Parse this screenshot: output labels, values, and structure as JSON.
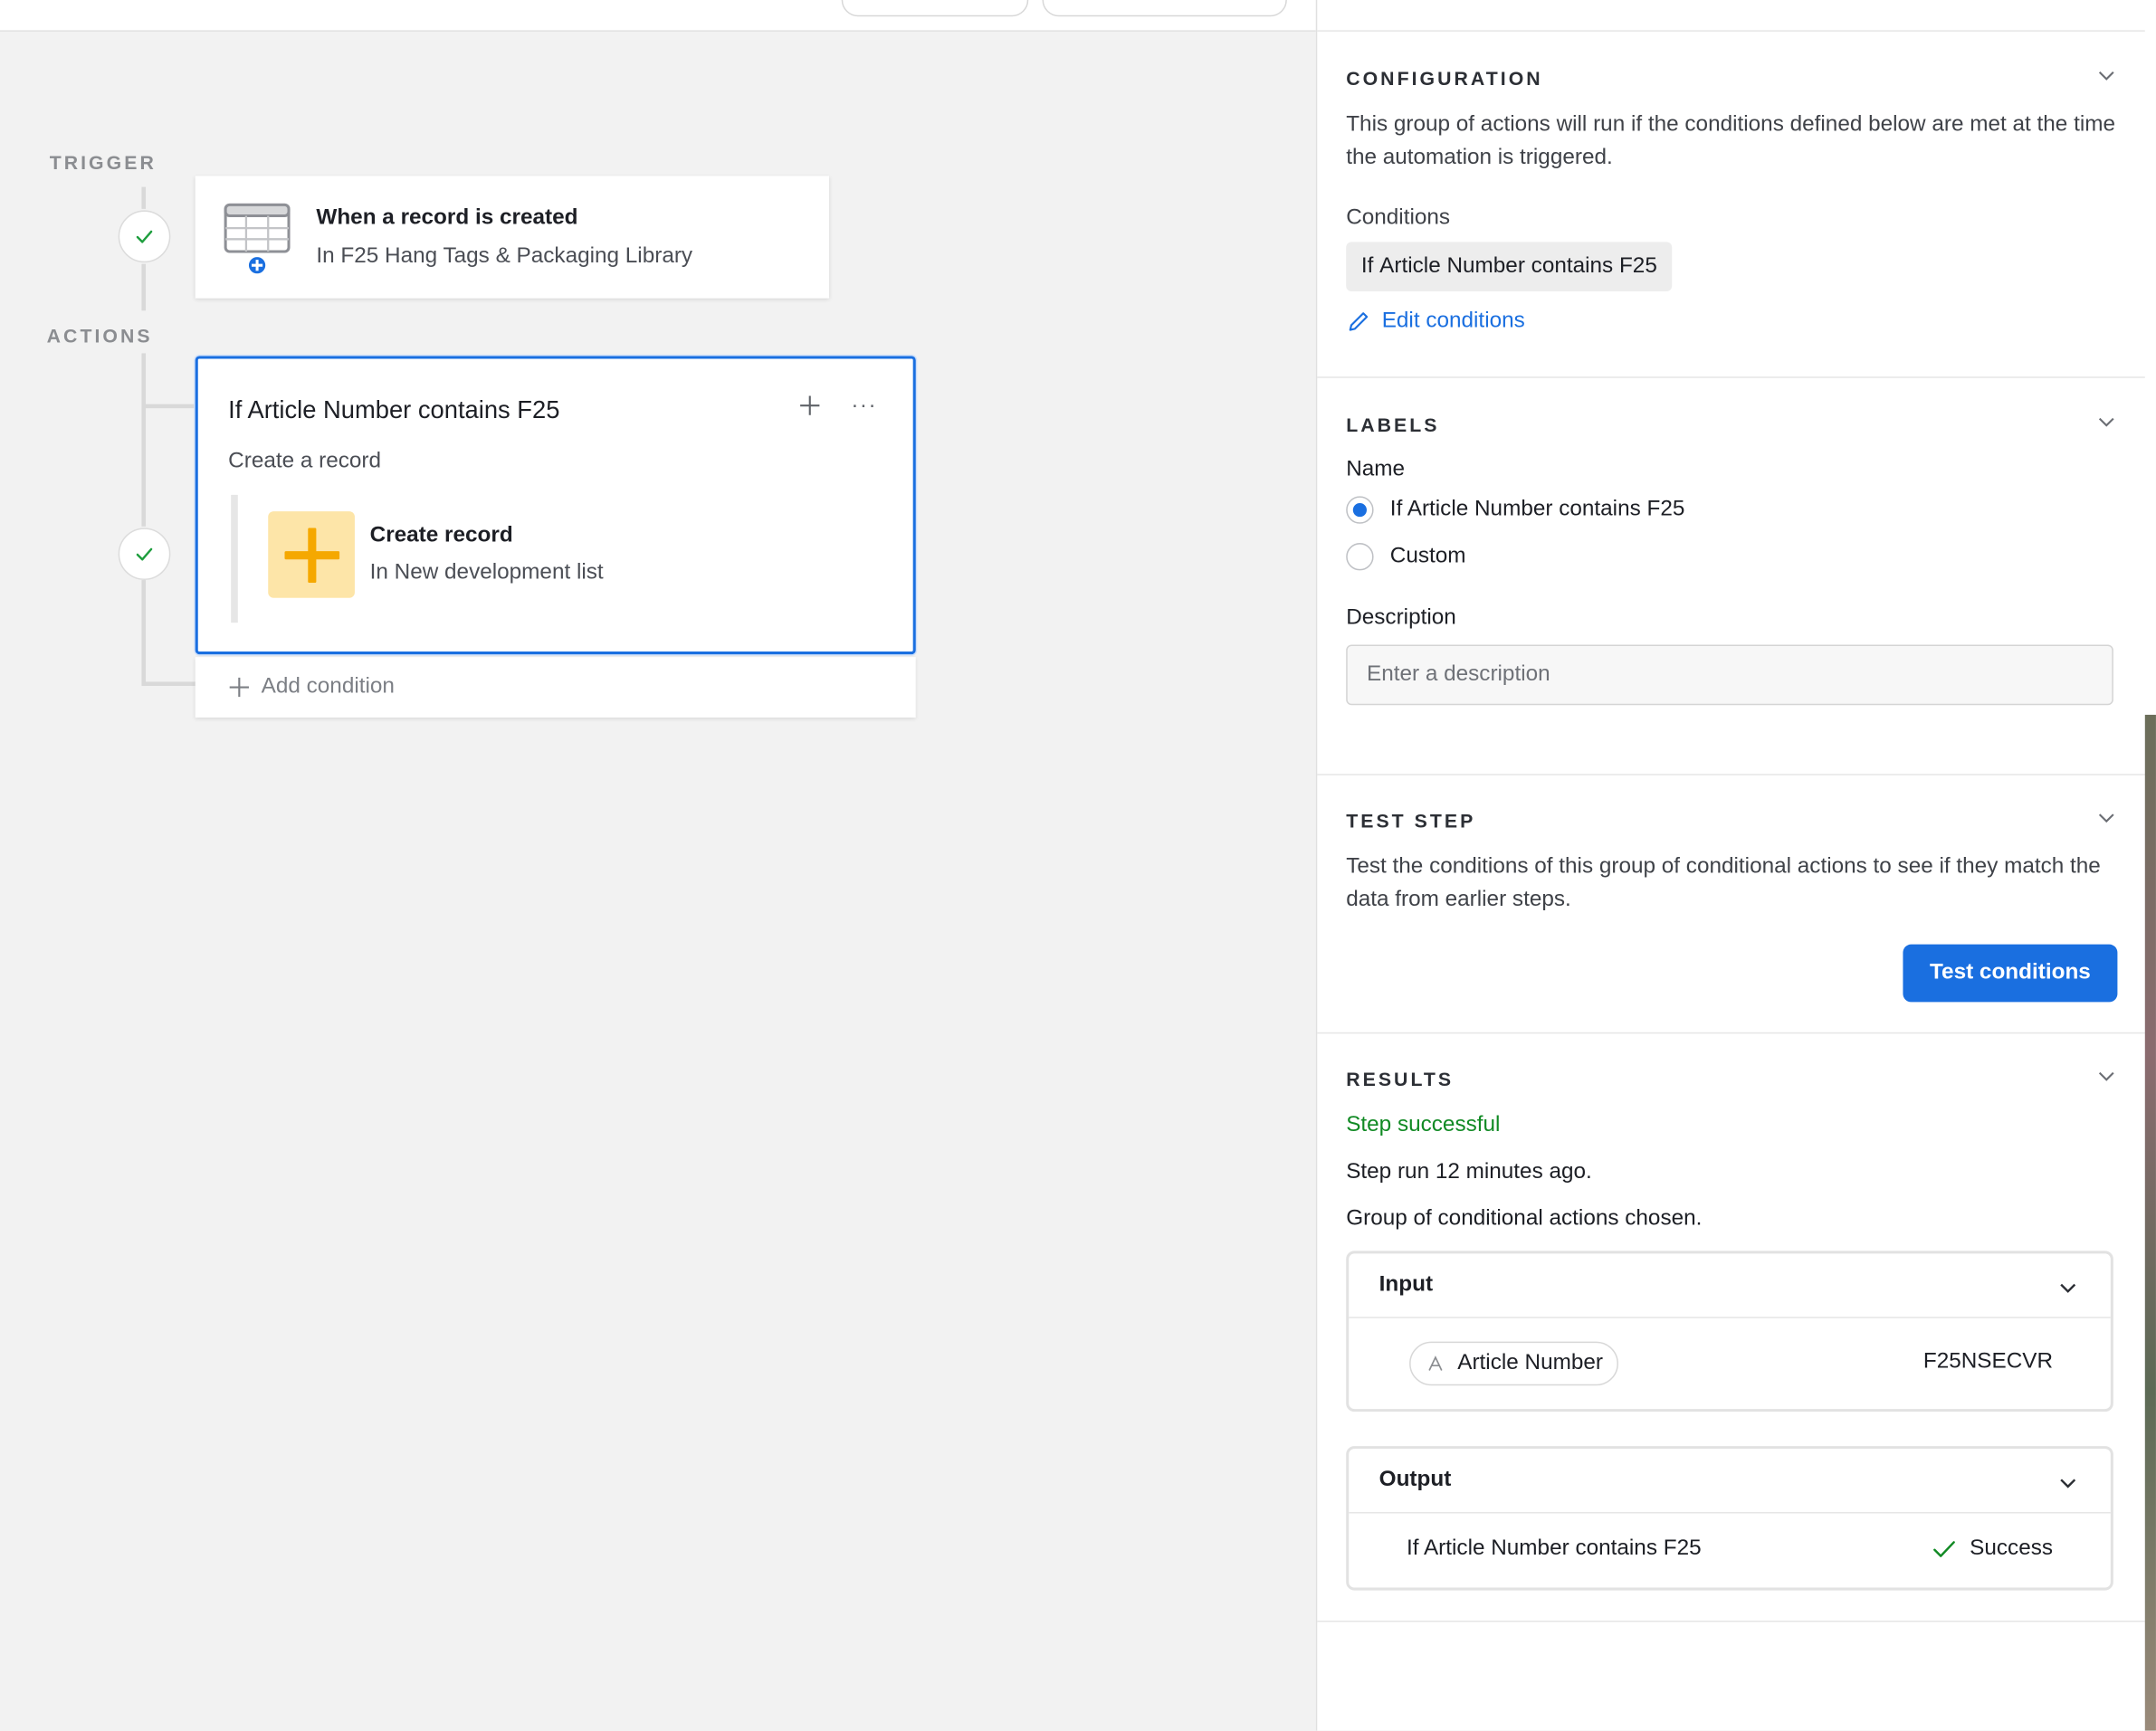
{
  "canvas": {
    "trigger_label": "TRIGGER",
    "actions_label": "ACTIONS",
    "trigger_card": {
      "title": "When a record is created",
      "subtitle": "In F25 Hang Tags & Packaging Library",
      "icon": "table-add-icon"
    },
    "action_group": {
      "title": "If Article Number contains F25",
      "subtitle": "Create a record",
      "add_icon": "plus-icon",
      "more_icon": "ellipsis-icon",
      "step": {
        "title": "Create record",
        "subtitle": "In New development list",
        "icon": "plus-icon"
      }
    },
    "add_condition_label": "Add condition"
  },
  "panel": {
    "configuration": {
      "heading": "CONFIGURATION",
      "description": "This group of actions will run if the conditions defined below are met at the time the automation is triggered.",
      "conditions_label": "Conditions",
      "condition_prefix": "If ",
      "condition_field": "Article Number",
      "condition_suffix": " contains F25",
      "edit_label": "Edit conditions"
    },
    "labels": {
      "heading": "LABELS",
      "name_label": "Name",
      "option_default_prefix": "If ",
      "option_default_field": "Article Number",
      "option_default_suffix": " contains F25",
      "option_custom": "Custom",
      "selected": "default",
      "description_label": "Description",
      "description_placeholder": "Enter a description",
      "description_value": ""
    },
    "test_step": {
      "heading": "TEST STEP",
      "description": "Test the conditions of this group of conditional actions to see if they match the data from earlier steps.",
      "button_label": "Test conditions"
    },
    "results": {
      "heading": "RESULTS",
      "status": "Step successful",
      "run_time": "Step run 12 minutes ago.",
      "chosen": "Group of conditional actions chosen.",
      "input": {
        "heading": "Input",
        "field_name": "Article Number",
        "field_value": "F25NSECVR"
      },
      "output": {
        "heading": "Output",
        "cond_prefix": "If ",
        "cond_field": "Article Number",
        "cond_suffix": " contains F25",
        "result": "Success"
      }
    }
  },
  "colors": {
    "accent": "#1a6fe0",
    "success": "#118a24",
    "step_icon_bg": "#fde5a8",
    "step_icon": "#f5a800"
  }
}
